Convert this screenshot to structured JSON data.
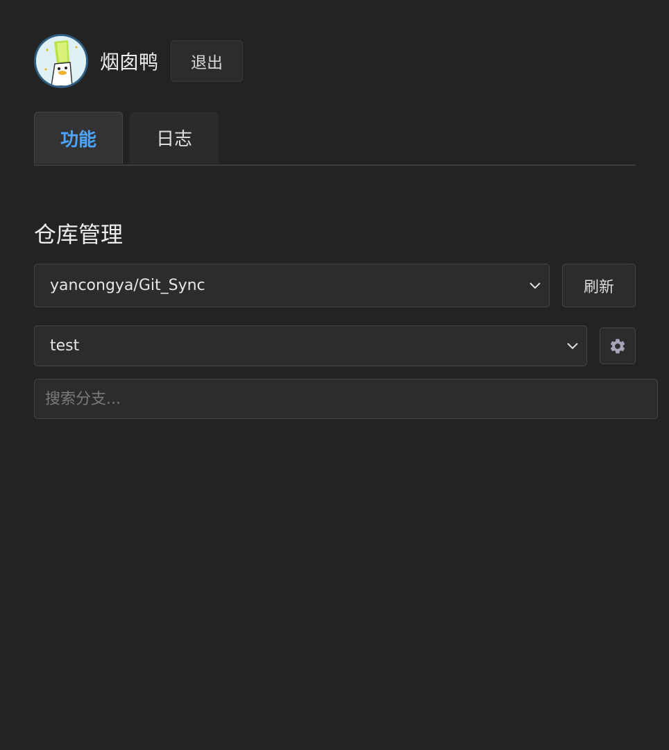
{
  "header": {
    "username": "烟囱鸭",
    "logout_label": "退出"
  },
  "tabs": [
    {
      "label": "功能",
      "active": true
    },
    {
      "label": "日志",
      "active": false
    }
  ],
  "main": {
    "section_title": "仓库管理",
    "repo_select_value": "yancongya/Git_Sync",
    "refresh_label": "刷新",
    "branch_select_value": "test",
    "search_placeholder": "搜索分支..."
  },
  "icons": {
    "avatar": "duck-leek-avatar",
    "settings": "gear-icon",
    "dropdown": "chevron-down-icon"
  },
  "colors": {
    "background": "#232323",
    "accent": "#4ea5ff"
  }
}
